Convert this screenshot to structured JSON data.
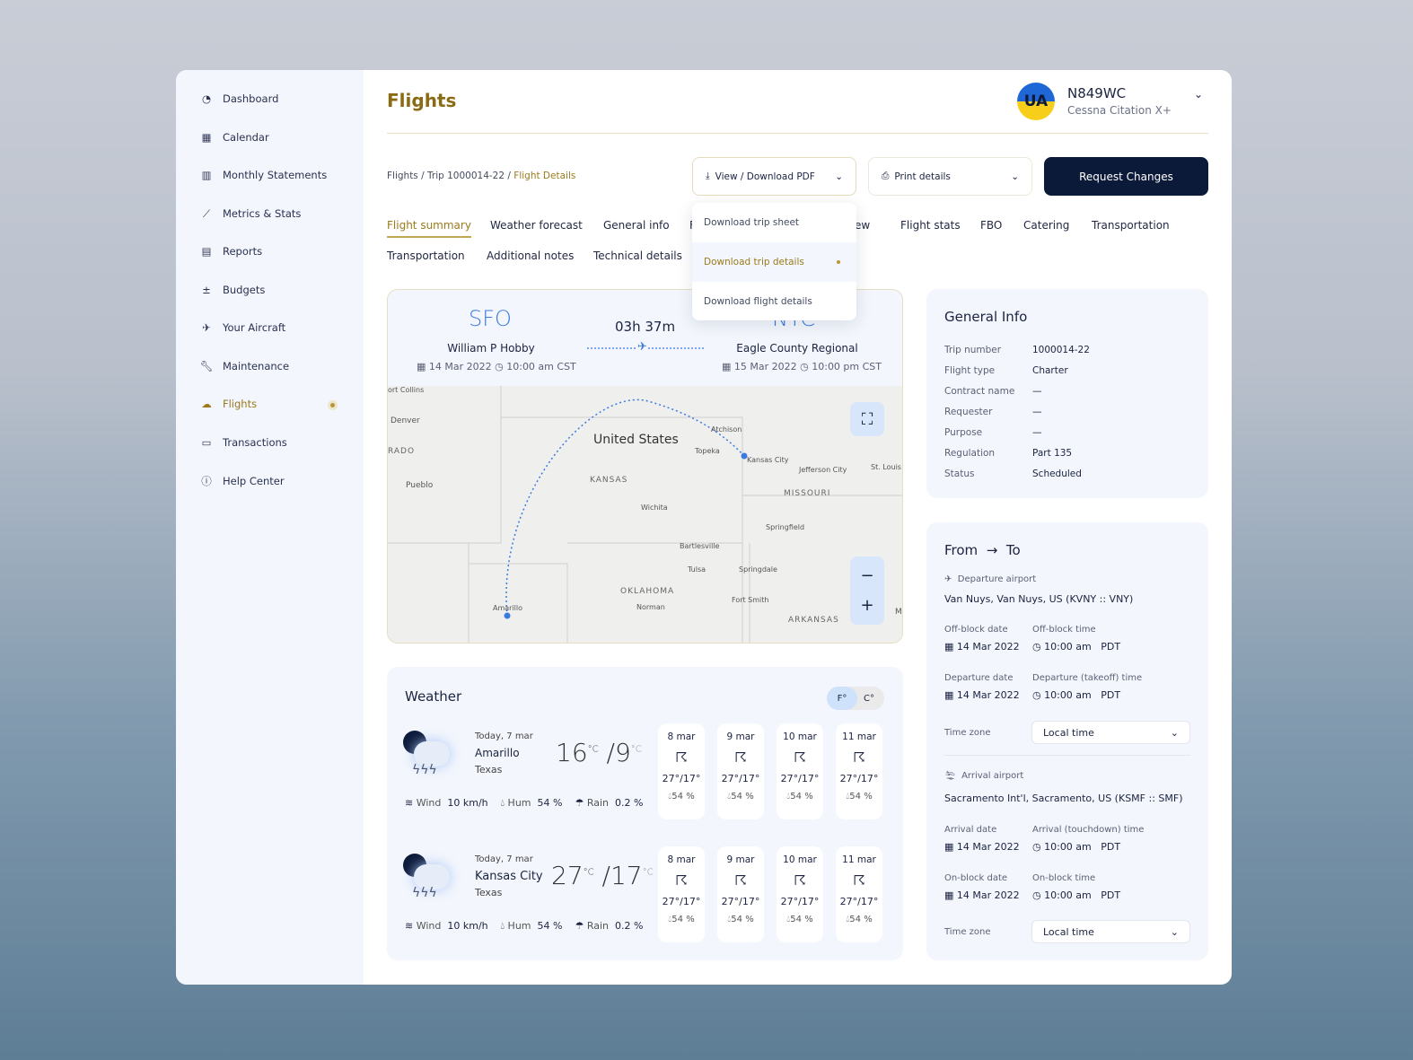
{
  "sidebar": {
    "items": [
      {
        "label": "Dashboard",
        "icon": "dashboard-icon"
      },
      {
        "label": "Calendar",
        "icon": "calendar-icon"
      },
      {
        "label": "Monthly Statements",
        "icon": "bar-chart-icon"
      },
      {
        "label": "Metrics & Stats",
        "icon": "line-chart-icon"
      },
      {
        "label": "Reports",
        "icon": "document-icon"
      },
      {
        "label": "Budgets",
        "icon": "calculator-icon"
      },
      {
        "label": "Your Aircraft",
        "icon": "plane-icon"
      },
      {
        "label": "Maintenance",
        "icon": "wrench-icon"
      },
      {
        "label": "Flights",
        "icon": "flights-icon",
        "active": true
      },
      {
        "label": "Transactions",
        "icon": "card-icon"
      },
      {
        "label": "Help Center",
        "icon": "help-icon"
      }
    ]
  },
  "header": {
    "title": "Flights",
    "avatar": "UA",
    "tail": "N849WC",
    "model": "Cessna Citation X+"
  },
  "breadcrumb": {
    "a": "Flights",
    "b": "Trip 1000014-22",
    "c": "Flight Details",
    "sep": "/"
  },
  "toolbar": {
    "pdf": "View / Download PDF",
    "print": "Print details",
    "request": "Request Changes"
  },
  "dropdown": [
    "Download trip sheet",
    "Download trip details",
    "Download flight details"
  ],
  "tabs": [
    "Flight summary",
    "Weather forecast",
    "General info",
    "F",
    "Crew",
    "Flight stats",
    "FBO",
    "Catering",
    "Transportation",
    "Transportation",
    "Additional notes",
    "Technical details"
  ],
  "route": {
    "from_code": "SFO",
    "to_code": "NYC",
    "duration": "03h 37m",
    "from_airport": "William P Hobby",
    "to_airport": "Eagle County Regional",
    "from_date": "14 Mar 2022",
    "from_time": "10:00 am CST",
    "to_date": "15 Mar 2022",
    "to_time": "10:00 pm CST"
  },
  "map": {
    "labels": [
      "United States",
      "KANSAS",
      "MISSOURI",
      "OKLAHOMA",
      "ARKANSAS",
      "RADO",
      "Denver",
      "Pueblo",
      "Topeka",
      "Atchison",
      "Kansas City",
      "Jefferson City",
      "St. Louis",
      "Wichita",
      "Springfield",
      "Bartlesville",
      "Tulsa",
      "Springdale",
      "Fort Smith",
      "Norman",
      "Amarillo",
      "ort Collins",
      "M"
    ]
  },
  "weather": {
    "title": "Weather",
    "f": "F°",
    "c": "C°",
    "cities": [
      {
        "date": "Today, 7 mar",
        "city": "Amarillo",
        "state": "Texas",
        "hi": "16",
        "lo": "9",
        "unit": "°C",
        "wind_label": "Wind",
        "wind": "10 km/h",
        "hum_label": "Hum",
        "hum": "54 %",
        "rain_label": "Rain",
        "rain": "0.2 %"
      },
      {
        "date": "Today, 7 mar",
        "city": "Kansas City",
        "state": "Texas",
        "hi": "27",
        "lo": "17",
        "unit": "°C",
        "wind_label": "Wind",
        "wind": "10 km/h",
        "hum_label": "Hum",
        "hum": "54 %",
        "rain_label": "Rain",
        "rain": "0.2 %"
      }
    ],
    "forecast": [
      {
        "d": "8 mar",
        "t": "27°/17°",
        "h": "54 %"
      },
      {
        "d": "9 mar",
        "t": "27°/17°",
        "h": "54 %"
      },
      {
        "d": "10 mar",
        "t": "27°/17°",
        "h": "54 %"
      },
      {
        "d": "11 mar",
        "t": "27°/17°",
        "h": "54 %"
      }
    ]
  },
  "general": {
    "title": "General Info",
    "rows": [
      [
        "Trip number",
        "1000014-22"
      ],
      [
        "Flight type",
        "Charter"
      ],
      [
        "Contract name",
        "—"
      ],
      [
        "Requester",
        "—"
      ],
      [
        "Purpose",
        "—"
      ],
      [
        "Regulation",
        "Part 135"
      ],
      [
        "Status",
        "Scheduled"
      ]
    ]
  },
  "fromto": {
    "from": "From",
    "to": "To",
    "arrow": "→",
    "dep_label": "Departure airport",
    "dep": "Van Nuys, Van Nuys, US (KVNY :: VNY)",
    "arr_label": "Arrival airport",
    "arr": "Sacramento Int'l, Sacramento, US (KSMF :: SMF)",
    "blocks": [
      [
        "Off-block date",
        "Off-block time",
        "14 Mar 2022",
        "10:00 am",
        "PDT"
      ],
      [
        "Departure date",
        "Departure (takeoff) time",
        "14 Mar 2022",
        "10:00 am",
        "PDT"
      ],
      [
        "Arrival date",
        "Arrival (touchdown) time",
        "14 Mar 2022",
        "10:00 am",
        "PDT"
      ],
      [
        "On-block date",
        "On-block time",
        "14 Mar 2022",
        "10:00 am",
        "PDT"
      ]
    ],
    "tz_label": "Time zone",
    "tz": "Local time"
  },
  "colors": {
    "accent": "#9a7a1c",
    "navy": "#0c1a3a",
    "blue": "#3b7be0"
  }
}
